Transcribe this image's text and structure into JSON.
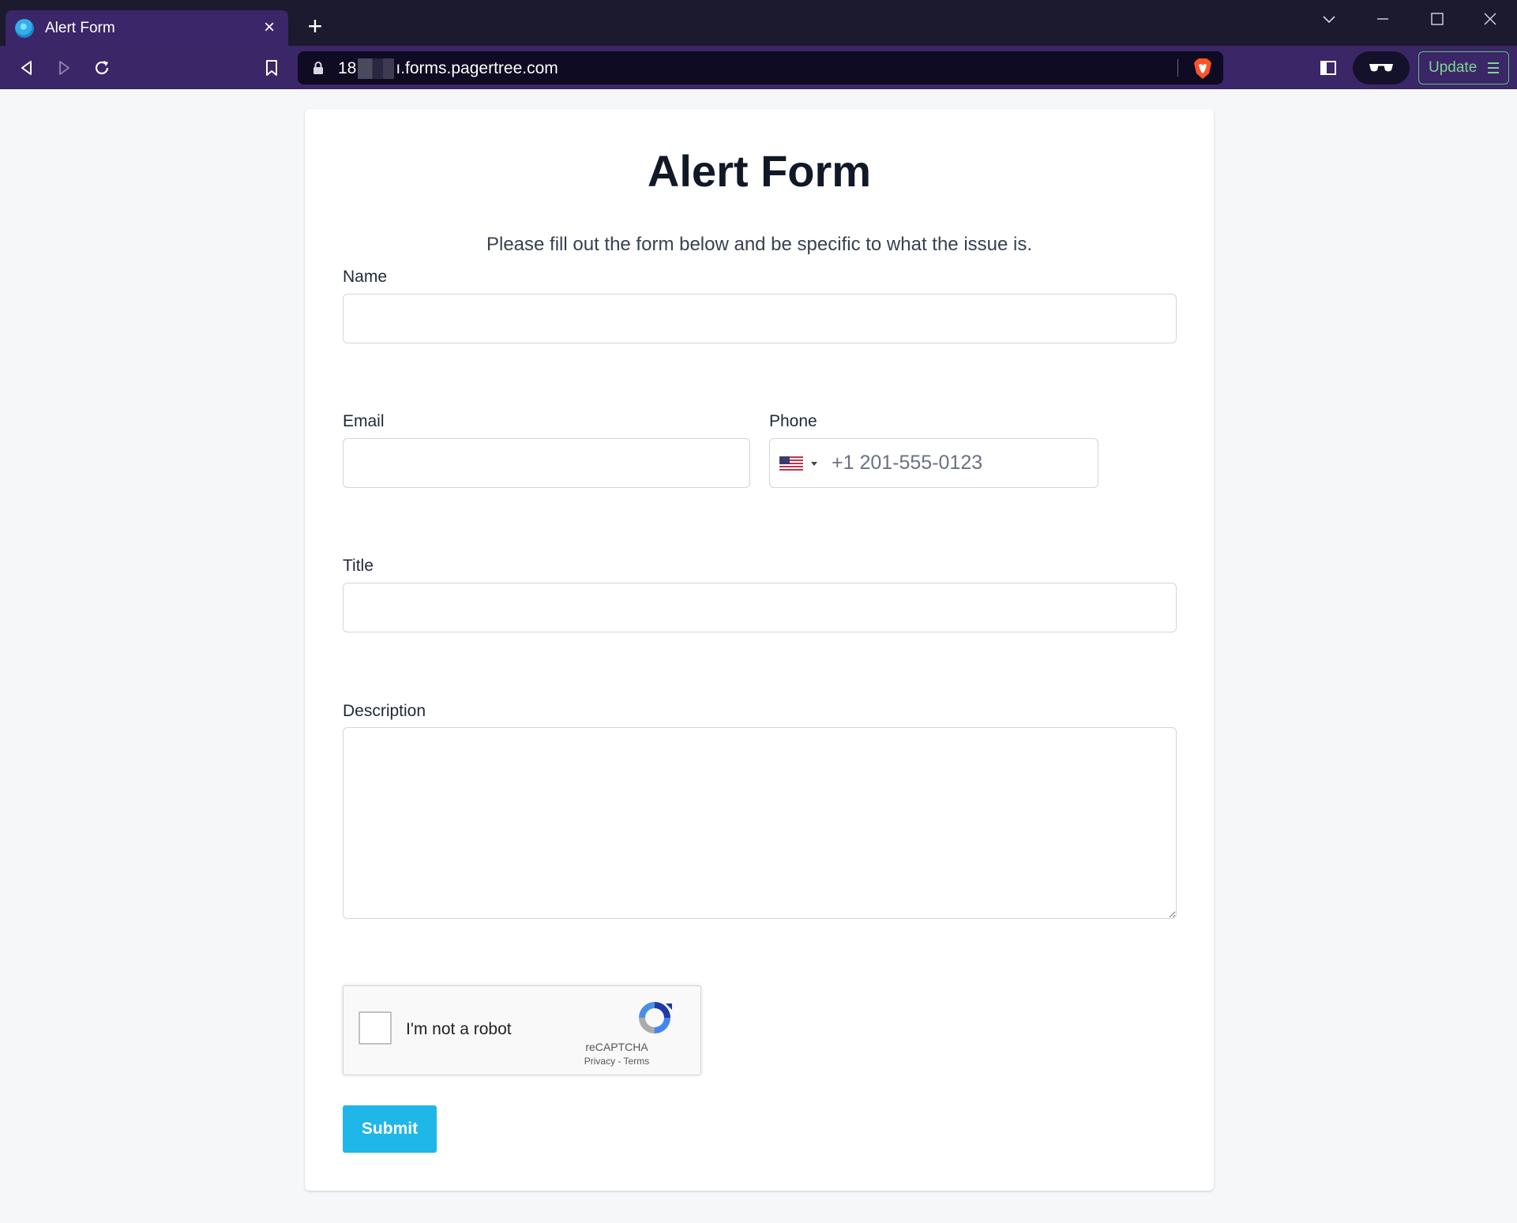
{
  "browser": {
    "tab_title": "Alert Form",
    "url_prefix": "18",
    "url_suffix": "ı.forms.pagertree.com",
    "update_label": "Update"
  },
  "form": {
    "title": "Alert Form",
    "subtitle": "Please fill out the form below and be specific to what the issue is.",
    "name_label": "Name",
    "name_value": "",
    "email_label": "Email",
    "email_value": "",
    "phone_label": "Phone",
    "phone_placeholder": "+1 201-555-0123",
    "phone_country_icon": "us-flag-icon",
    "title_label": "Title",
    "title_value": "",
    "description_label": "Description",
    "description_value": "",
    "submit_label": "Submit"
  },
  "recaptcha": {
    "label": "I'm not a robot",
    "brand": "reCAPTCHA",
    "links": "Privacy - Terms"
  },
  "colors": {
    "submit_bg": "#1fb6e8",
    "browser_toolbar": "#3b2667",
    "update_accent": "#7fd496"
  }
}
